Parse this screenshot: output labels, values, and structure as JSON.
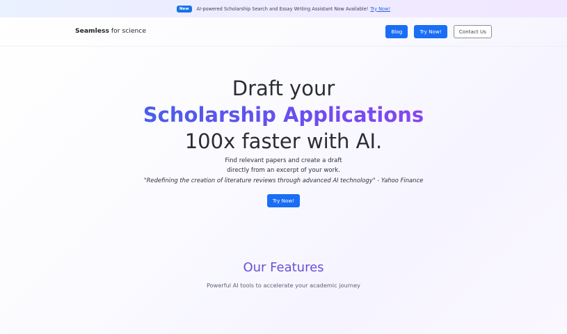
{
  "announcement": {
    "badge": "New",
    "text": "AI-powered Scholarship Search and Essay Writing Assistant Now Available!",
    "link": "Try Now!"
  },
  "navbar": {
    "brand_bold": "Seamless",
    "brand_rest": " for science",
    "buttons": {
      "blog": "Blog",
      "try_now": "Try Now!",
      "contact": "Contact Us"
    }
  },
  "hero": {
    "line1": "Draft your",
    "line2": "Scholarship Applications",
    "line3": "100x faster with AI.",
    "sub1": "Find relevant papers and create a draft",
    "sub2": "directly from an excerpt of your work.",
    "quote": "\"Redefining the creation of literature reviews through advanced AI technology\" - Yahoo Finance",
    "cta": "Try Now!"
  },
  "features": {
    "title": "Our Features",
    "subtitle": "Powerful AI tools to accelerate your academic journey"
  },
  "colors": {
    "primary": "#1a6ef5",
    "gradient_start": "#2b6de8",
    "gradient_end": "#a43ff0",
    "features_title": "#6a4fd6"
  }
}
